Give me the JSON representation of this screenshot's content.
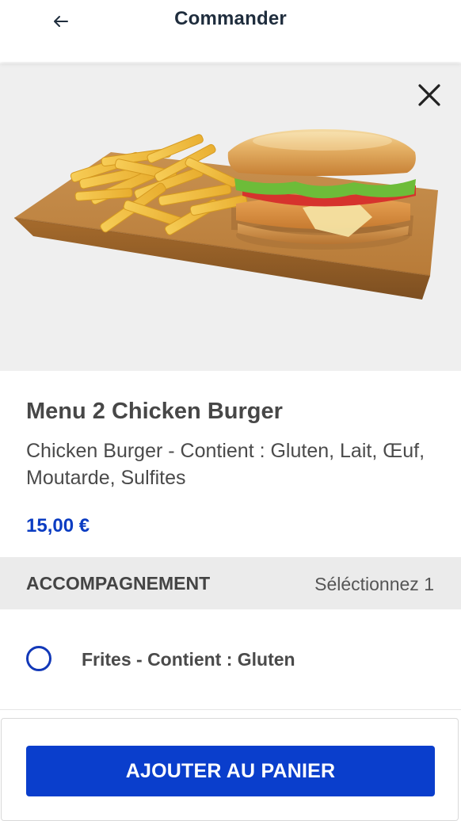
{
  "header": {
    "back_icon": "arrow-left-icon",
    "title": "Commander"
  },
  "hero": {
    "close_icon": "close-icon",
    "image_subject": "burger-and-fries-icon"
  },
  "product": {
    "name": "Menu 2 Chicken Burger",
    "description": "Chicken Burger - Contient : Gluten, Lait, Œuf, Moutarde, Sulfites",
    "price": "15,00 €"
  },
  "section": {
    "title": "ACCOMPAGNEMENT",
    "hint": "Séléctionnez 1"
  },
  "options": [
    {
      "label": "Frites - Contient : Gluten",
      "selected": false
    }
  ],
  "footer": {
    "add_button_label": "AJOUTER AU PANIER"
  },
  "colors": {
    "accent": "#0a3ecc",
    "price": "#0b3cc2",
    "title": "#1f2d3d"
  }
}
